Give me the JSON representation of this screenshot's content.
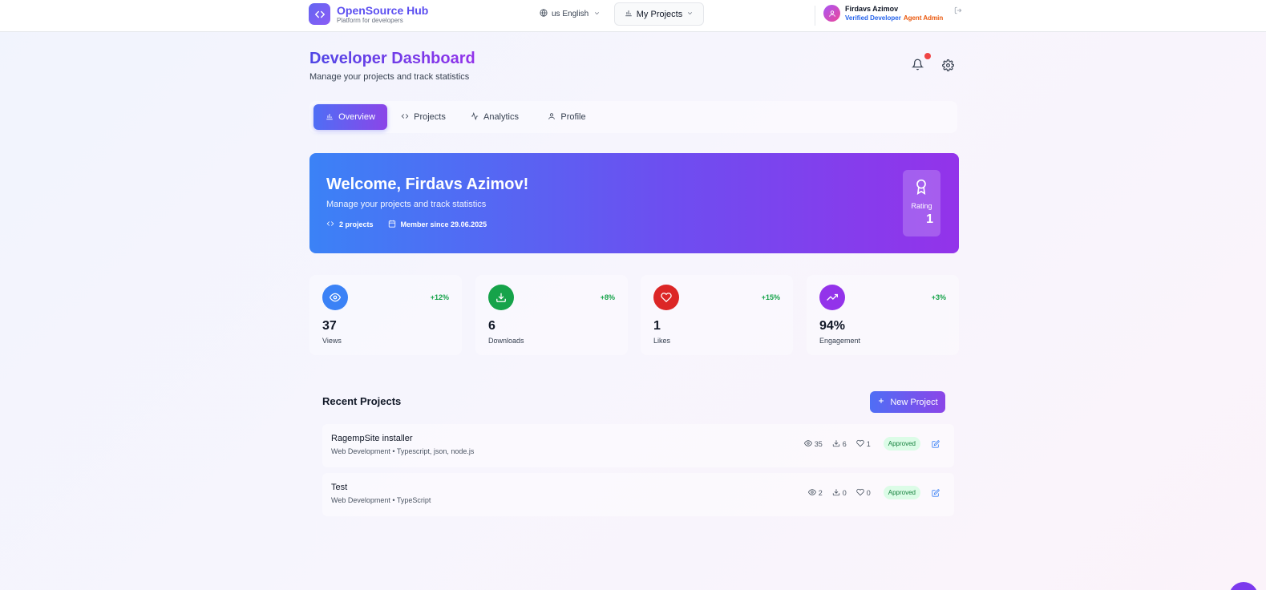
{
  "topbar": {
    "brand_name": "OpenSource Hub",
    "brand_sub": "Platform for developers",
    "language": "us English",
    "my_projects": "My Projects",
    "user_name": "Firdavs Azimov",
    "role_verified": "Verified Developer",
    "role_admin": "Agent Admin"
  },
  "header": {
    "title": "Developer Dashboard",
    "subtitle": "Manage your projects and track statistics"
  },
  "tabs": [
    {
      "label": "Overview",
      "icon": "bar-chart-icon"
    },
    {
      "label": "Projects",
      "icon": "code-icon"
    },
    {
      "label": "Analytics",
      "icon": "activity-icon"
    },
    {
      "label": "Profile",
      "icon": "user-icon"
    }
  ],
  "welcome": {
    "title": "Welcome, Firdavs Azimov!",
    "subtitle": "Manage your projects and track statistics",
    "projects": "2 projects",
    "member_since": "Member since 29.06.2025",
    "rating_label": "Rating",
    "rating_value": "1"
  },
  "stats": [
    {
      "value": "37",
      "label": "Views",
      "change": "+12%",
      "color": "#3b82f6",
      "icon": "eye-icon"
    },
    {
      "value": "6",
      "label": "Downloads",
      "change": "+8%",
      "color": "#16a34a",
      "icon": "download-icon"
    },
    {
      "value": "1",
      "label": "Likes",
      "change": "+15%",
      "color": "#dc2626",
      "icon": "heart-icon"
    },
    {
      "value": "94%",
      "label": "Engagement",
      "change": "+3%",
      "color": "#9333ea",
      "icon": "trending-up-icon"
    }
  ],
  "recent": {
    "title": "Recent Projects",
    "new_project": "New Project",
    "projects": [
      {
        "name": "RagempSite installer",
        "meta": "Web Development • Typescript, json, node.js",
        "views": "35",
        "downloads": "6",
        "likes": "1",
        "status": "Approved"
      },
      {
        "name": "Test",
        "meta": "Web Development • TypeScript",
        "views": "2",
        "downloads": "0",
        "likes": "0",
        "status": "Approved"
      }
    ]
  }
}
